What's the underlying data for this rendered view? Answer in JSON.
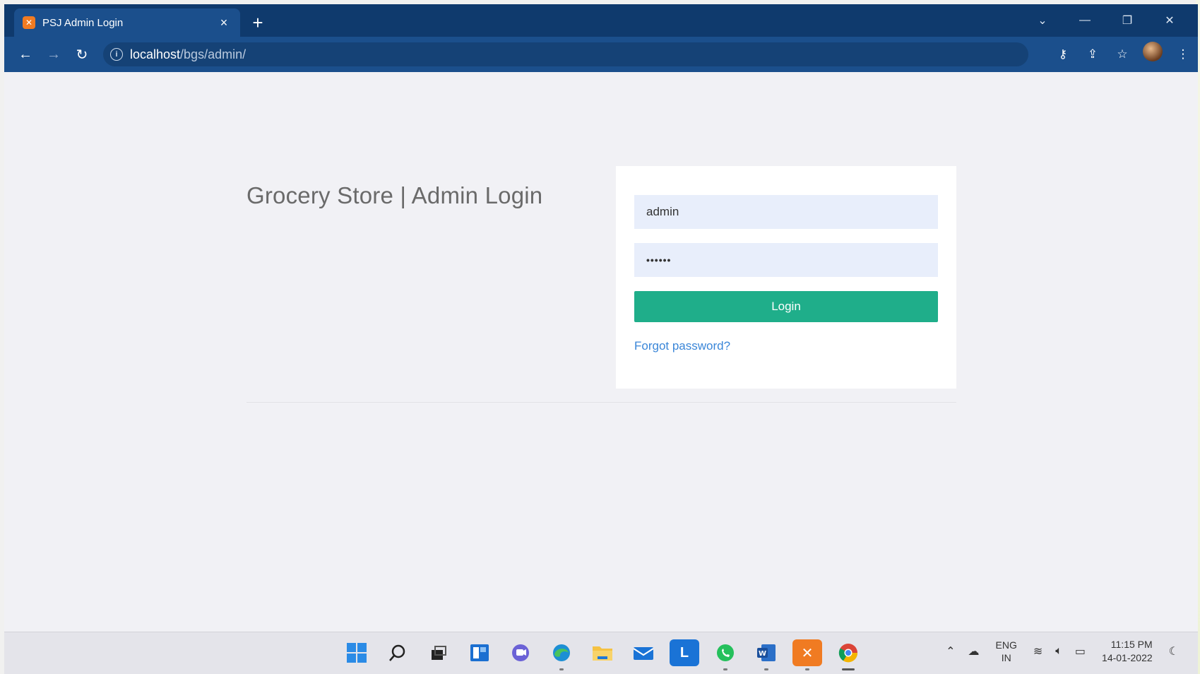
{
  "browser": {
    "tab": {
      "title": "PSJ Admin Login",
      "favicon": "xampp-icon"
    },
    "url": {
      "host": "localhost",
      "path": "/bgs/admin/"
    }
  },
  "page": {
    "title": "Grocery Store | Admin Login",
    "form": {
      "username_value": "admin",
      "password_value": "••••••",
      "login_label": "Login",
      "forgot_label": "Forgot password?"
    },
    "colors": {
      "button": "#1fae8a",
      "input_bg": "#e8eefb",
      "link": "#3a86d8"
    }
  },
  "taskbar": {
    "apps": [
      "windows-start-icon",
      "search-icon",
      "task-view-icon",
      "widgets-icon",
      "teams-chat-icon",
      "edge-icon",
      "file-explorer-icon",
      "mail-icon",
      "l-app-icon",
      "whatsapp-icon",
      "word-icon",
      "xampp-icon",
      "chrome-icon"
    ],
    "lang_top": "ENG",
    "lang_bottom": "IN",
    "time": "11:15 PM",
    "date": "14-01-2022"
  }
}
